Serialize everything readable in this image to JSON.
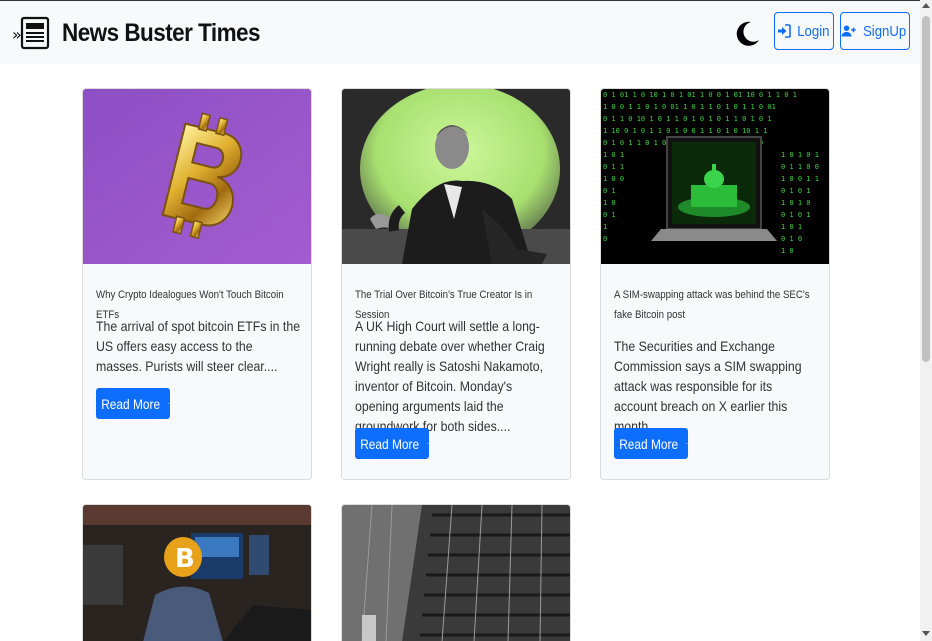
{
  "header": {
    "title": "News Buster Times",
    "logo_icon": "newspaper-icon",
    "theme_icon": "moon-icon",
    "login_label": "Login",
    "signup_label": "SignUp",
    "accent_color": "#0d6efd"
  },
  "cards": [
    {
      "title": "Why Crypto Idealogues Won't Touch Bitcoin ETFs",
      "description": "The arrival of spot bitcoin ETFs in the US offers easy access to the masses. Purists will steer clear....",
      "button_label": "Read More",
      "image": "gold-bitcoin-on-purple"
    },
    {
      "title": "The Trial Over Bitcoin's True Creator Is in Session",
      "description": "A UK High Court will settle a long-running debate over whether Craig Wright really is Satoshi Nakamoto, inventor of Bitcoin. Monday's opening arguments laid the groundwork for both sides....",
      "button_label": "Read More",
      "image": "man-seated-green-background"
    },
    {
      "title": "A SIM-swapping attack was behind the SEC's fake Bitcoin post",
      "description": "The Securities and Exchange Commission says a SIM swapping attack was responsible for its account breach on X earlier this month....",
      "button_label": "Read More",
      "image": "laptop-capitol-matrix-code"
    },
    {
      "title": "",
      "description": "",
      "button_label": "",
      "image": "trading-floor-bitcoin-logo"
    },
    {
      "title": "",
      "description": "",
      "button_label": "",
      "image": "mining-rig-racks"
    }
  ]
}
